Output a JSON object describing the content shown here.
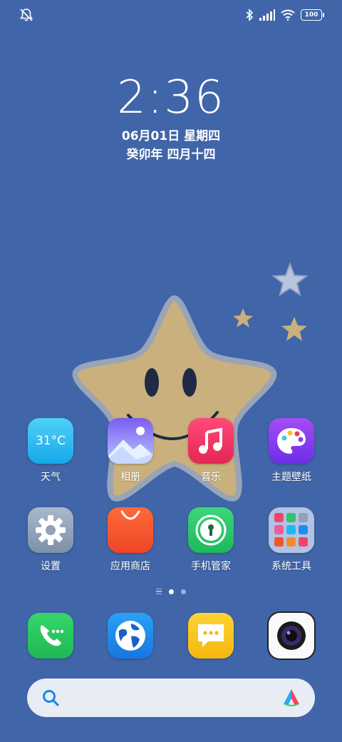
{
  "status_bar": {
    "left_icon": "bell-muted-icon",
    "right_icons": [
      "bluetooth-icon",
      "signal-icon",
      "wifi-icon"
    ],
    "battery": "100"
  },
  "clock": {
    "time": "2:36",
    "date": "06月01日 星期四",
    "lunar": "癸卯年 四月十四"
  },
  "home_apps": [
    {
      "label": "天气",
      "icon": "weather-icon",
      "temp": "31°C"
    },
    {
      "label": "相册",
      "icon": "gallery-icon"
    },
    {
      "label": "音乐",
      "icon": "music-icon"
    },
    {
      "label": "主题壁纸",
      "icon": "theme-palette-icon"
    },
    {
      "label": "设置",
      "icon": "settings-gear-icon"
    },
    {
      "label": "应用商店",
      "icon": "app-store-bag-icon"
    },
    {
      "label": "手机管家",
      "icon": "security-manager-icon"
    },
    {
      "label": "系统工具",
      "icon": "system-tools-folder-icon"
    }
  ],
  "dock": [
    {
      "icon": "phone-icon"
    },
    {
      "icon": "browser-globe-icon"
    },
    {
      "icon": "messages-icon"
    },
    {
      "icon": "camera-icon"
    }
  ],
  "page_indicator": {
    "pages": 2,
    "active": 1
  },
  "search": {
    "left_icon": "search-icon",
    "right_icon": "assistant-logo-icon"
  },
  "colors": {
    "background": "#4065a8",
    "weather": "#1fb8f0",
    "music": "#f0365e",
    "theme": "#8b3ff0",
    "settings": "#8fa2b8",
    "app_store": "#f2542d",
    "security": "#2ec46a",
    "phone": "#2bc860",
    "browser": "#1b8ef0",
    "messages": "#f9c41e"
  }
}
